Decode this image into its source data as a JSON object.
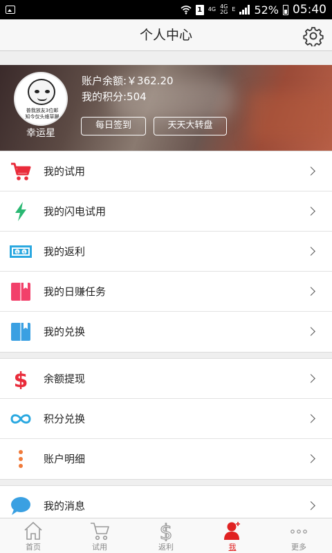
{
  "status_bar": {
    "network_a": "4G",
    "network_b": "4G",
    "network_c": "2G",
    "network_d": "E",
    "sim": "1",
    "battery": "52%",
    "time": "05:40"
  },
  "header": {
    "title": "个人中心",
    "settings_icon": "gear-icon"
  },
  "profile": {
    "avatar_caption_1": "普我放友3位邮",
    "avatar_caption_2": "知今仅头维草蹦",
    "username": "幸运星",
    "balance": "账户余额:￥362.20",
    "points": "我的积分:504",
    "checkin_button": "每日签到",
    "wheel_button": "天天大转盘"
  },
  "group1": [
    {
      "label": "我的试用",
      "icon": "cart-icon"
    },
    {
      "label": "我的闪电试用",
      "icon": "lightning-icon"
    },
    {
      "label": "我的返利",
      "icon": "money-icon"
    },
    {
      "label": "我的日赚任务",
      "icon": "book-icon"
    },
    {
      "label": "我的兑换",
      "icon": "book-icon"
    }
  ],
  "group2": [
    {
      "label": "余额提现",
      "icon": "dollar-icon"
    },
    {
      "label": "积分兑换",
      "icon": "infinity-icon"
    },
    {
      "label": "账户明细",
      "icon": "dots-icon"
    }
  ],
  "group3": [
    {
      "label": "我的消息",
      "icon": "chat-icon"
    }
  ],
  "tabbar": [
    {
      "label": "首页",
      "icon": "home-icon"
    },
    {
      "label": "试用",
      "icon": "cart-icon"
    },
    {
      "label": "返利",
      "icon": "dollar-icon"
    },
    {
      "label": "我",
      "icon": "user-icon",
      "active": true
    },
    {
      "label": "更多",
      "icon": "more-icon"
    }
  ],
  "colors": {
    "accent": "#e02222",
    "green": "#2ab873",
    "blue": "#2aa8e0",
    "pink": "#f2406a",
    "orange": "#f07a3a"
  }
}
